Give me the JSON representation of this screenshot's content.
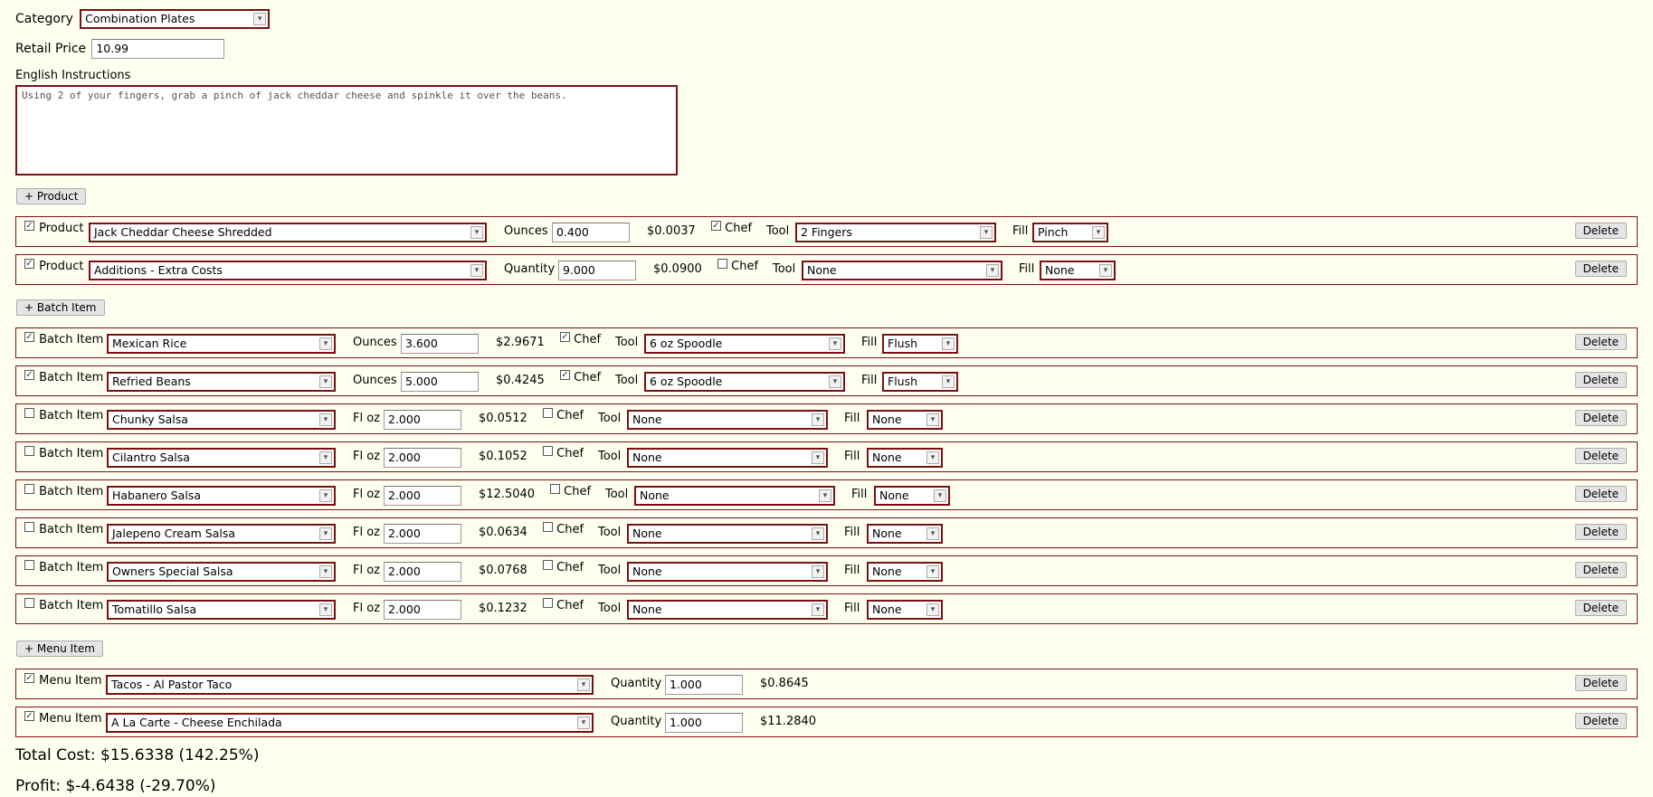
{
  "category": {
    "label": "Category",
    "value": "Combination Plates"
  },
  "retail_price": {
    "label": "Retail Price",
    "value": "10.99"
  },
  "instructions": {
    "label": "English Instructions",
    "value": "Using 2 of your fingers, grab a pinch of jack cheddar cheese and spinkle it over the beans."
  },
  "add_product_label": "+ Product",
  "add_batch_label": "+ Batch Item",
  "add_menu_label": "+ Menu Item",
  "delete_label": "Delete",
  "chef_label": "Chef",
  "tool_label": "Tool",
  "fill_label": "Fill",
  "products": [
    {
      "checked": true,
      "type_label": "Product",
      "name": "Jack Cheddar Cheese Shredded",
      "unit": "Ounces",
      "amount": "0.400",
      "cost": "$0.0037",
      "chef": true,
      "tool": "2 Fingers",
      "fill": "Pinch"
    },
    {
      "checked": true,
      "type_label": "Product",
      "name": "Additions - Extra Costs",
      "unit": "Quantity",
      "amount": "9.000",
      "cost": "$0.0900",
      "chef": false,
      "tool": "None",
      "fill": "None"
    }
  ],
  "batch_items": [
    {
      "checked": true,
      "type_label": "Batch Item",
      "name": "Mexican Rice",
      "unit": "Ounces",
      "amount": "3.600",
      "cost": "$2.9671",
      "chef": true,
      "tool": "6 oz Spoodle",
      "fill": "Flush"
    },
    {
      "checked": true,
      "type_label": "Batch Item",
      "name": "Refried Beans",
      "unit": "Ounces",
      "amount": "5.000",
      "cost": "$0.4245",
      "chef": true,
      "tool": "6 oz Spoodle",
      "fill": "Flush"
    },
    {
      "checked": false,
      "type_label": "Batch Item",
      "name": "Chunky Salsa",
      "unit": "Fl oz",
      "amount": "2.000",
      "cost": "$0.0512",
      "chef": false,
      "tool": "None",
      "fill": "None"
    },
    {
      "checked": false,
      "type_label": "Batch Item",
      "name": "Cilantro Salsa",
      "unit": "Fl oz",
      "amount": "2.000",
      "cost": "$0.1052",
      "chef": false,
      "tool": "None",
      "fill": "None"
    },
    {
      "checked": false,
      "type_label": "Batch Item",
      "name": "Habanero Salsa",
      "unit": "Fl oz",
      "amount": "2.000",
      "cost": "$12.5040",
      "chef": false,
      "tool": "None",
      "fill": "None"
    },
    {
      "checked": false,
      "type_label": "Batch Item",
      "name": "Jalepeno Cream Salsa",
      "unit": "Fl oz",
      "amount": "2.000",
      "cost": "$0.0634",
      "chef": false,
      "tool": "None",
      "fill": "None"
    },
    {
      "checked": false,
      "type_label": "Batch Item",
      "name": "Owners Special Salsa",
      "unit": "Fl oz",
      "amount": "2.000",
      "cost": "$0.0768",
      "chef": false,
      "tool": "None",
      "fill": "None"
    },
    {
      "checked": false,
      "type_label": "Batch Item",
      "name": "Tomatillo Salsa",
      "unit": "Fl oz",
      "amount": "2.000",
      "cost": "$0.1232",
      "chef": false,
      "tool": "None",
      "fill": "None"
    }
  ],
  "menu_items": [
    {
      "checked": true,
      "type_label": "Menu Item",
      "name": "Tacos - Al Pastor Taco",
      "unit": "Quantity",
      "amount": "1.000",
      "cost": "$0.8645"
    },
    {
      "checked": true,
      "type_label": "Menu Item",
      "name": "A La Carte - Cheese Enchilada",
      "unit": "Quantity",
      "amount": "1.000",
      "cost": "$11.2840"
    }
  ],
  "totals": {
    "total_cost": "Total Cost: $15.6338 (142.25%)",
    "profit": "Profit: $-4.6438 (-29.70%)"
  },
  "colors": {
    "page_bg": "#fffff0",
    "border": "#7a1010"
  }
}
